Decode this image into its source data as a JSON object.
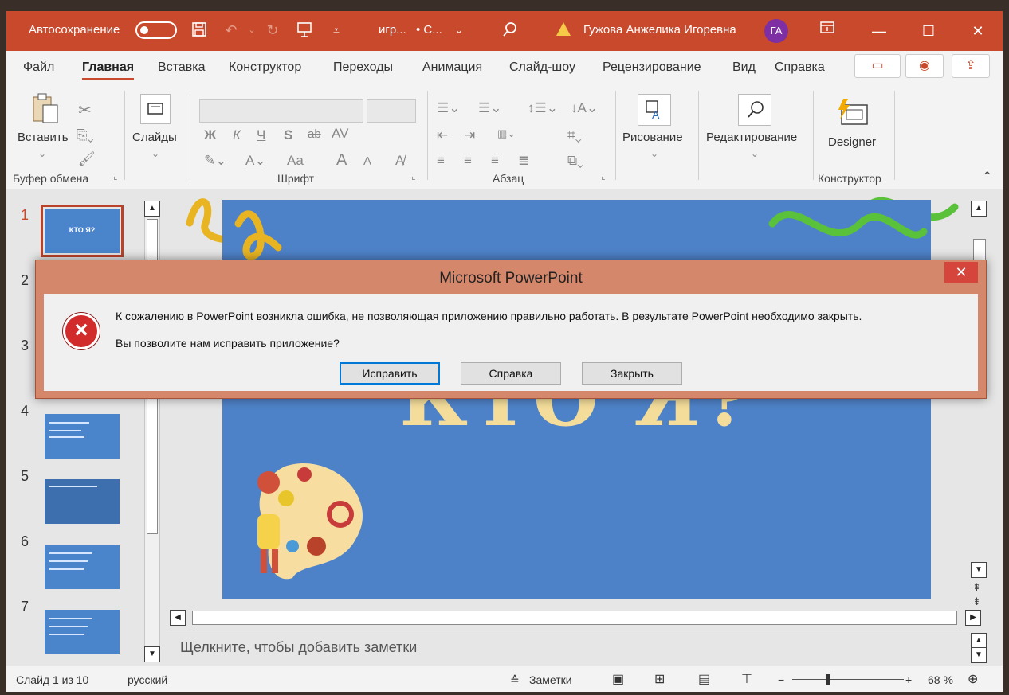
{
  "titlebar": {
    "autosave_label": "Автосохранение",
    "filename": "игр...",
    "saved_state": "• С...",
    "user_name": "Гужова Анжелика Игоревна",
    "user_initials": "ГА"
  },
  "menu_tabs": [
    "Файл",
    "Главная",
    "Вставка",
    "Конструктор",
    "Переходы",
    "Анимация",
    "Слайд-шоу",
    "Рецензирование",
    "Вид",
    "Справка"
  ],
  "active_tab": "Главная",
  "ribbon": {
    "clipboard": {
      "paste_label": "Вставить",
      "group_label": "Буфер обмена"
    },
    "slides": {
      "label": "Слайды"
    },
    "font": {
      "group_label": "Шрифт",
      "bold": "Ж",
      "italic": "К",
      "underline": "Ч",
      "strike": "S",
      "strike2": "ab",
      "spacing": "AV",
      "case": "Aa",
      "grow": "A",
      "shrink": "A"
    },
    "paragraph": {
      "group_label": "Абзац"
    },
    "drawing": {
      "label": "Рисование"
    },
    "editing": {
      "label": "Редактирование"
    },
    "designer": {
      "label": "Designer",
      "group_label": "Конструктор"
    }
  },
  "slides_pane": {
    "numbers": [
      "1",
      "2",
      "3",
      "4",
      "5",
      "6",
      "7"
    ],
    "thumb1_title": "КТО Я?"
  },
  "slide": {
    "title": "КТО Я?"
  },
  "notes": {
    "placeholder": "Щелкните, чтобы добавить заметки"
  },
  "statusbar": {
    "slide_info": "Слайд 1 из 10",
    "language": "русский",
    "notes_label": "Заметки",
    "zoom": "68 %"
  },
  "dialog": {
    "title": "Microsoft PowerPoint",
    "message_line1": "К сожалению в PowerPoint возникла ошибка, не позволяющая приложению правильно работать. В результате PowerPoint необходимо закрыть.",
    "message_line2": "Вы позволите нам исправить приложение?",
    "buttons": {
      "fix": "Исправить",
      "help": "Справка",
      "close": "Закрыть"
    }
  },
  "colors": {
    "accent": "#c8492b",
    "slide_bg": "#4e82c8",
    "title_color": "#f4dd9a",
    "avatar": "#7e2fa3"
  }
}
